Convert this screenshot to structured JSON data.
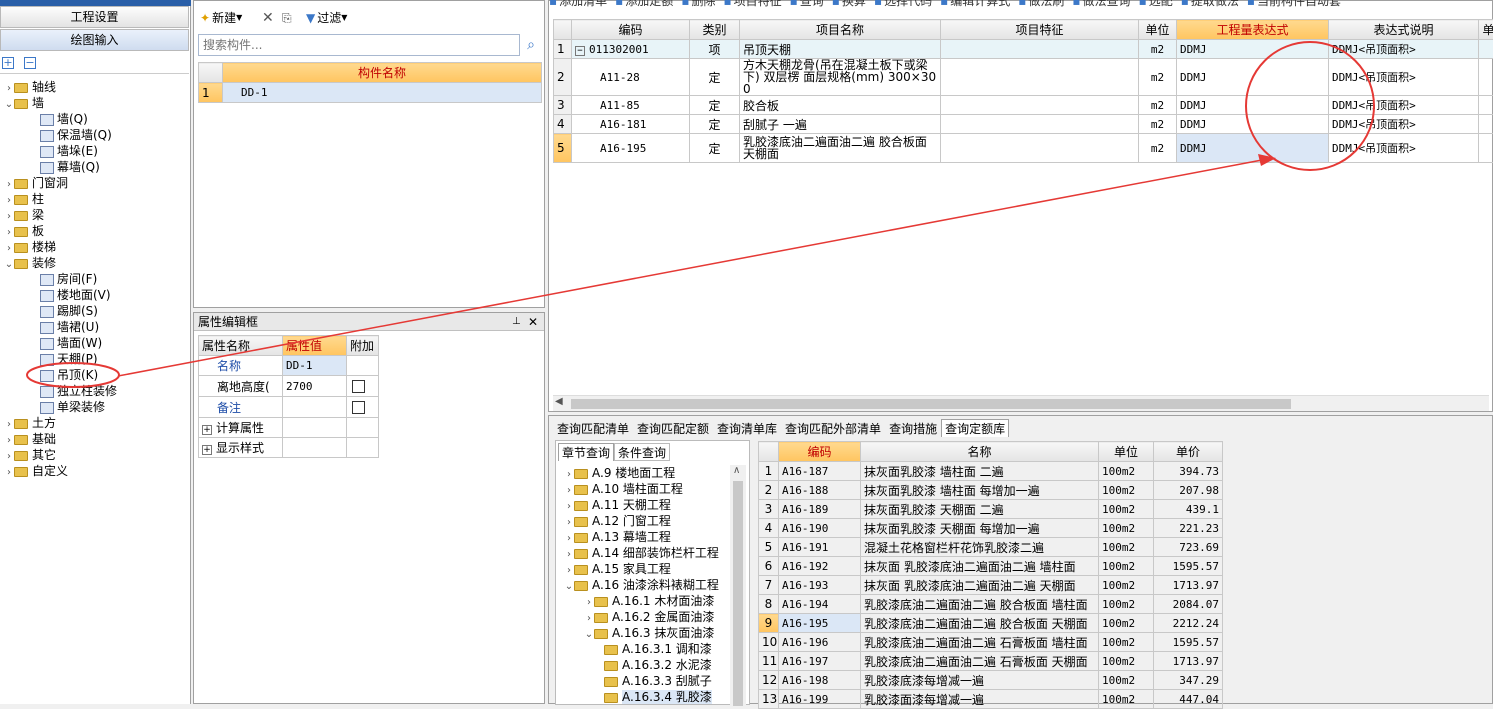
{
  "top_left_title": "工程设置",
  "nav": {
    "gongcheng": "工程设置",
    "huitu": "绘图输入"
  },
  "tree": [
    {
      "label": "轴线",
      "depth": 0,
      "open": false
    },
    {
      "label": "墙",
      "depth": 0,
      "open": true
    },
    {
      "label": "墙(Q)",
      "depth": 1
    },
    {
      "label": "保温墙(Q)",
      "depth": 1
    },
    {
      "label": "墙垛(E)",
      "depth": 1
    },
    {
      "label": "幕墙(Q)",
      "depth": 1
    },
    {
      "label": "门窗洞",
      "depth": 0,
      "open": false
    },
    {
      "label": "柱",
      "depth": 0,
      "open": false
    },
    {
      "label": "梁",
      "depth": 0,
      "open": false
    },
    {
      "label": "板",
      "depth": 0,
      "open": false
    },
    {
      "label": "楼梯",
      "depth": 0,
      "open": false
    },
    {
      "label": "装修",
      "depth": 0,
      "open": true
    },
    {
      "label": "房间(F)",
      "depth": 1
    },
    {
      "label": "楼地面(V)",
      "depth": 1
    },
    {
      "label": "踢脚(S)",
      "depth": 1
    },
    {
      "label": "墙裙(U)",
      "depth": 1
    },
    {
      "label": "墙面(W)",
      "depth": 1
    },
    {
      "label": "天棚(P)",
      "depth": 1
    },
    {
      "label": "吊顶(K)",
      "depth": 1
    },
    {
      "label": "独立柱装修",
      "depth": 1
    },
    {
      "label": "单梁装修",
      "depth": 1
    },
    {
      "label": "土方",
      "depth": 0,
      "open": false
    },
    {
      "label": "基础",
      "depth": 0,
      "open": false
    },
    {
      "label": "其它",
      "depth": 0,
      "open": false
    },
    {
      "label": "自定义",
      "depth": 0,
      "open": false
    }
  ],
  "comp_toolbar": {
    "new": "新建",
    "filter": "过滤"
  },
  "search_placeholder": "搜索构件...",
  "comp_header": "构件名称",
  "comp_rows": [
    {
      "n": "1",
      "name": "DD-1"
    }
  ],
  "prop": {
    "title": "属性编辑框",
    "col_name": "属性名称",
    "col_val": "属性值",
    "col_add": "附加",
    "rows": [
      {
        "name": "名称",
        "val": "DD-1"
      },
      {
        "name": "离地高度(",
        "val": "2700"
      },
      {
        "name": "备注",
        "val": ""
      },
      {
        "name": "计算属性",
        "val": ""
      },
      {
        "name": "显示样式",
        "val": ""
      }
    ]
  },
  "main_toolbar": [
    "添加清单",
    "添加定额",
    "删除",
    "项目特征",
    "查询",
    "换算",
    "选择代码",
    "编辑计算式",
    "做法刷",
    "做法查询",
    "选配",
    "提取做法",
    "当前构件自动套"
  ],
  "main_cols": [
    "编码",
    "类别",
    "项目名称",
    "项目特征",
    "单位",
    "工程量表达式",
    "表达式说明",
    "单"
  ],
  "main_rows": [
    {
      "n": "1",
      "code": "011302001",
      "type": "项",
      "name": "吊顶天棚",
      "feat": "",
      "unit": "m2",
      "expr": "DDMJ",
      "desc": "DDMJ<吊顶面积>"
    },
    {
      "n": "2",
      "code": "A11-28",
      "type": "定",
      "name": "方木天棚龙骨(吊在混凝土板下或梁下) 双层楞 面层规格(mm) 300×300",
      "feat": "",
      "unit": "m2",
      "expr": "DDMJ",
      "desc": "DDMJ<吊顶面积>"
    },
    {
      "n": "3",
      "code": "A11-85",
      "type": "定",
      "name": "胶合板",
      "feat": "",
      "unit": "m2",
      "expr": "DDMJ",
      "desc": "DDMJ<吊顶面积>"
    },
    {
      "n": "4",
      "code": "A16-181",
      "type": "定",
      "name": "刮腻子 一遍",
      "feat": "",
      "unit": "m2",
      "expr": "DDMJ",
      "desc": "DDMJ<吊顶面积>"
    },
    {
      "n": "5",
      "code": "A16-195",
      "type": "定",
      "name": "乳胶漆底油二遍面油二遍 胶合板面 天棚面",
      "feat": "",
      "unit": "m2",
      "expr": "DDMJ",
      "desc": "DDMJ<吊顶面积>"
    }
  ],
  "bottom_tabs": [
    "查询匹配清单",
    "查询匹配定额",
    "查询清单库",
    "查询匹配外部清单",
    "查询措施",
    "查询定额库"
  ],
  "sub_tabs": [
    "章节查询",
    "条件查询"
  ],
  "chapters": [
    {
      "label": "A.9 楼地面工程",
      "depth": 0
    },
    {
      "label": "A.10 墙柱面工程",
      "depth": 0
    },
    {
      "label": "A.11 天棚工程",
      "depth": 0
    },
    {
      "label": "A.12 门窗工程",
      "depth": 0
    },
    {
      "label": "A.13 幕墙工程",
      "depth": 0
    },
    {
      "label": "A.14 细部装饰栏杆工程",
      "depth": 0
    },
    {
      "label": "A.15 家具工程",
      "depth": 0
    },
    {
      "label": "A.16 油漆涂料裱糊工程",
      "depth": 0
    },
    {
      "label": "A.16.1 木材面油漆",
      "depth": 1
    },
    {
      "label": "A.16.2 金属面油漆",
      "depth": 1
    },
    {
      "label": "A.16.3 抹灰面油漆",
      "depth": 1
    },
    {
      "label": "A.16.3.1 调和漆",
      "depth": 2
    },
    {
      "label": "A.16.3.2 水泥漆",
      "depth": 2
    },
    {
      "label": "A.16.3.3 刮腻子",
      "depth": 2
    },
    {
      "label": "A.16.3.4 乳胶漆",
      "depth": 2
    }
  ],
  "quota_cols": [
    "编码",
    "名称",
    "单位",
    "单价"
  ],
  "quota_rows": [
    {
      "n": "1",
      "code": "A16-187",
      "name": "抹灰面乳胶漆 墙柱面 二遍",
      "unit": "100m2",
      "price": "394.73"
    },
    {
      "n": "2",
      "code": "A16-188",
      "name": "抹灰面乳胶漆 墙柱面 每增加一遍",
      "unit": "100m2",
      "price": "207.98"
    },
    {
      "n": "3",
      "code": "A16-189",
      "name": "抹灰面乳胶漆 天棚面 二遍",
      "unit": "100m2",
      "price": "439.1"
    },
    {
      "n": "4",
      "code": "A16-190",
      "name": "抹灰面乳胶漆 天棚面 每增加一遍",
      "unit": "100m2",
      "price": "221.23"
    },
    {
      "n": "5",
      "code": "A16-191",
      "name": "混凝土花格窗栏杆花饰乳胶漆二遍",
      "unit": "100m2",
      "price": "723.69"
    },
    {
      "n": "6",
      "code": "A16-192",
      "name": "抹灰面 乳胶漆底油二遍面油二遍 墙柱面",
      "unit": "100m2",
      "price": "1595.57"
    },
    {
      "n": "7",
      "code": "A16-193",
      "name": "抹灰面 乳胶漆底油二遍面油二遍 天棚面",
      "unit": "100m2",
      "price": "1713.97"
    },
    {
      "n": "8",
      "code": "A16-194",
      "name": "乳胶漆底油二遍面油二遍 胶合板面 墙柱面",
      "unit": "100m2",
      "price": "2084.07"
    },
    {
      "n": "9",
      "code": "A16-195",
      "name": "乳胶漆底油二遍面油二遍 胶合板面 天棚面",
      "unit": "100m2",
      "price": "2212.24"
    },
    {
      "n": "10",
      "code": "A16-196",
      "name": "乳胶漆底油二遍面油二遍 石膏板面 墙柱面",
      "unit": "100m2",
      "price": "1595.57"
    },
    {
      "n": "11",
      "code": "A16-197",
      "name": "乳胶漆底油二遍面油二遍 石膏板面 天棚面",
      "unit": "100m2",
      "price": "1713.97"
    },
    {
      "n": "12",
      "code": "A16-198",
      "name": "乳胶漆底漆每增减一遍",
      "unit": "100m2",
      "price": "347.29"
    },
    {
      "n": "13",
      "code": "A16-199",
      "name": "乳胶漆面漆每增减一遍",
      "unit": "100m2",
      "price": "447.04"
    }
  ],
  "colors": {
    "accent": "#ffc560",
    "selected": "#dbe7f6",
    "annotation": "#e53935"
  }
}
